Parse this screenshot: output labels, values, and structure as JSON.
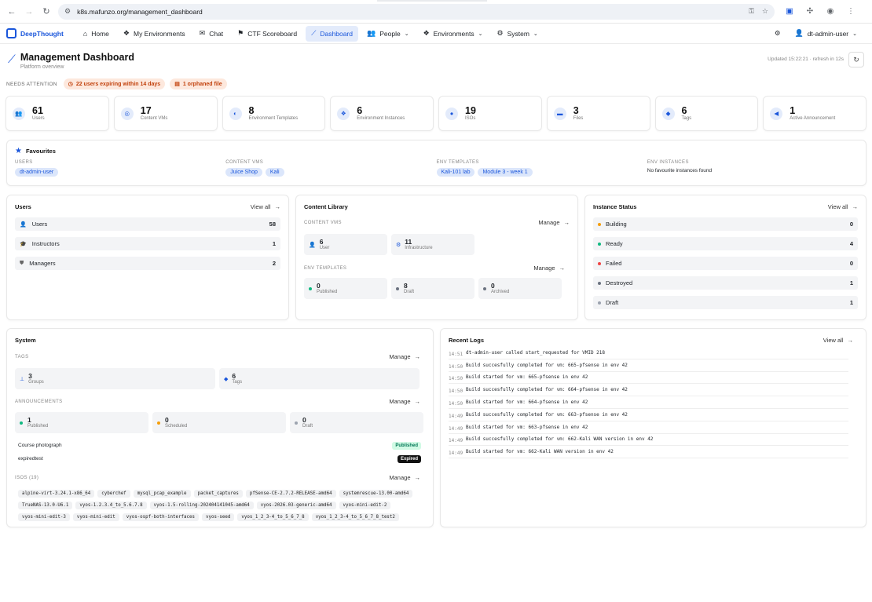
{
  "browser": {
    "url": "k8s.mafunzo.org/management_dashboard"
  },
  "nav": {
    "brand": "DeepThought",
    "items": [
      {
        "label": "Home",
        "icon": "home-icon",
        "glyph": "⌂"
      },
      {
        "label": "My Environments",
        "icon": "cubes-icon",
        "glyph": "❖"
      },
      {
        "label": "Chat",
        "icon": "chat-icon",
        "glyph": "✉"
      },
      {
        "label": "CTF Scoreboard",
        "icon": "flag-icon",
        "glyph": "⚑"
      },
      {
        "label": "Dashboard",
        "icon": "chart-icon",
        "glyph": "⟋",
        "active": true
      },
      {
        "label": "People",
        "icon": "people-icon",
        "glyph": "👥",
        "caret": true
      },
      {
        "label": "Environments",
        "icon": "cubes-icon",
        "glyph": "❖",
        "caret": true
      },
      {
        "label": "System",
        "icon": "gear-icon",
        "glyph": "⚙",
        "caret": true
      }
    ],
    "user": "dt-admin-user"
  },
  "header": {
    "title": "Management Dashboard",
    "subtitle": "Platform overview",
    "updated": "Updated 15:22:21 · refresh in 12s"
  },
  "attention": {
    "label": "NEEDS ATTENTION",
    "items": [
      "22 users expiring within 14 days",
      "1 orphaned file"
    ]
  },
  "stats": [
    {
      "value": "61",
      "label": "Users",
      "icon": "users-icon",
      "glyph": "👥"
    },
    {
      "value": "17",
      "label": "Content VMs",
      "icon": "vm-icon",
      "glyph": "◎"
    },
    {
      "value": "8",
      "label": "Environment Templates",
      "icon": "template-icon",
      "glyph": "◐"
    },
    {
      "value": "6",
      "label": "Environment Instances",
      "icon": "cubes-icon",
      "glyph": "❖"
    },
    {
      "value": "19",
      "label": "ISOs",
      "icon": "disc-icon",
      "glyph": "●"
    },
    {
      "value": "3",
      "label": "Files",
      "icon": "folder-icon",
      "glyph": "▬"
    },
    {
      "value": "6",
      "label": "Tags",
      "icon": "tag-icon",
      "glyph": "◆"
    },
    {
      "value": "1",
      "label": "Active Announcement",
      "icon": "megaphone-icon",
      "glyph": "◀"
    }
  ],
  "favourites": {
    "title": "Favourites",
    "groups": [
      {
        "label": "USERS",
        "chips": [
          "dt-admin-user"
        ]
      },
      {
        "label": "CONTENT VMS",
        "chips": [
          "Juice Shop",
          "Kali"
        ]
      },
      {
        "label": "ENV TEMPLATES",
        "chips": [
          "Kali-101 lab",
          "Module 3 - week 1"
        ]
      },
      {
        "label": "ENV INSTANCES",
        "empty": "No favourite instances found"
      }
    ]
  },
  "users_card": {
    "title": "Users",
    "link": "View all",
    "rows": [
      {
        "label": "Users",
        "value": "58",
        "glyph": "👤"
      },
      {
        "label": "Instructors",
        "value": "1",
        "glyph": "🎓"
      },
      {
        "label": "Managers",
        "value": "2",
        "glyph": "⛊"
      }
    ]
  },
  "content": {
    "title": "Content Library",
    "vms_label": "CONTENT VMS",
    "vms_link": "Manage",
    "vms": [
      {
        "value": "6",
        "label": "User"
      },
      {
        "value": "11",
        "label": "Infrastructure"
      }
    ],
    "tmpl_label": "ENV TEMPLATES",
    "tmpl_link": "Manage",
    "tmpl": [
      {
        "value": "0",
        "label": "Published",
        "color": "#10b981"
      },
      {
        "value": "8",
        "label": "Draft",
        "color": "#6b7280"
      },
      {
        "value": "0",
        "label": "Archived",
        "color": "#6b7280"
      }
    ]
  },
  "instance": {
    "title": "Instance Status",
    "link": "View all",
    "rows": [
      {
        "label": "Building",
        "value": "0",
        "color": "#f59e0b"
      },
      {
        "label": "Ready",
        "value": "4",
        "color": "#10b981"
      },
      {
        "label": "Failed",
        "value": "0",
        "color": "#ef4444"
      },
      {
        "label": "Destroyed",
        "value": "1",
        "color": "#6b7280"
      },
      {
        "label": "Draft",
        "value": "1",
        "color": "#9ca3af"
      }
    ]
  },
  "system": {
    "title": "System",
    "tags_label": "TAGS",
    "tags_link": "Manage",
    "tags": [
      {
        "value": "3",
        "label": "Groups"
      },
      {
        "value": "6",
        "label": "Tags"
      }
    ],
    "ann_label": "ANNOUNCEMENTS",
    "ann_link": "Manage",
    "ann": [
      {
        "value": "1",
        "label": "Published",
        "color": "#10b981"
      },
      {
        "value": "0",
        "label": "Scheduled",
        "color": "#f59e0b"
      },
      {
        "value": "0",
        "label": "Draft",
        "color": "#9ca3af"
      }
    ],
    "ann_list": [
      {
        "name": "Course photograph",
        "badge": "Published"
      },
      {
        "name": "expiredtest",
        "badge": "Expired"
      }
    ],
    "isos_label": "ISOS (19)",
    "isos_link": "Manage",
    "isos": [
      "alpine-virt-3.24.1-x86_64",
      "cyberchef",
      "mysql_pcap_example",
      "packet_captures",
      "pfSense-CE-2.7.2-RELEASE-amd64",
      "systemrescue-13.00-amd64",
      "TrueNAS-13.0-U6.1",
      "vyos-1.2.3.4_to_5.6.7.8",
      "vyos-1.5-rolling-202404141045-amd64",
      "vyos-2026.03-generic-amd64",
      "vyos-mini-edit-2",
      "vyos-mini-edit-3",
      "vyos-mini-edit",
      "vyos-ospf-both-interfaces",
      "vyos-seed",
      "vyos_1_2_3-4_to_5_6_7_8",
      "vyos_1_2_3-4_to_5_6_7_8_test2"
    ]
  },
  "logs": {
    "title": "Recent Logs",
    "link": "View all",
    "entries": [
      {
        "time": "14:51",
        "msg": "dt-admin-user called start_requested for VMID 218"
      },
      {
        "time": "14:50",
        "msg": "Build succesfully completed for vm: 665-pfsense in env 42"
      },
      {
        "time": "14:50",
        "msg": "Build started for vm: 665-pfsense in env 42"
      },
      {
        "time": "14:50",
        "msg": "Build succesfully completed for vm: 664-pfsense in env 42"
      },
      {
        "time": "14:50",
        "msg": "Build started for vm: 664-pfsense in env 42"
      },
      {
        "time": "14:49",
        "msg": "Build succesfully completed for vm: 663-pfsense in env 42"
      },
      {
        "time": "14:49",
        "msg": "Build started for vm: 663-pfsense in env 42"
      },
      {
        "time": "14:49",
        "msg": "Build succesfully completed for vm: 662-Kali WAN version in env 42"
      },
      {
        "time": "14:49",
        "msg": "Build started for vm: 662-Kali WAN version in env 42"
      }
    ]
  }
}
